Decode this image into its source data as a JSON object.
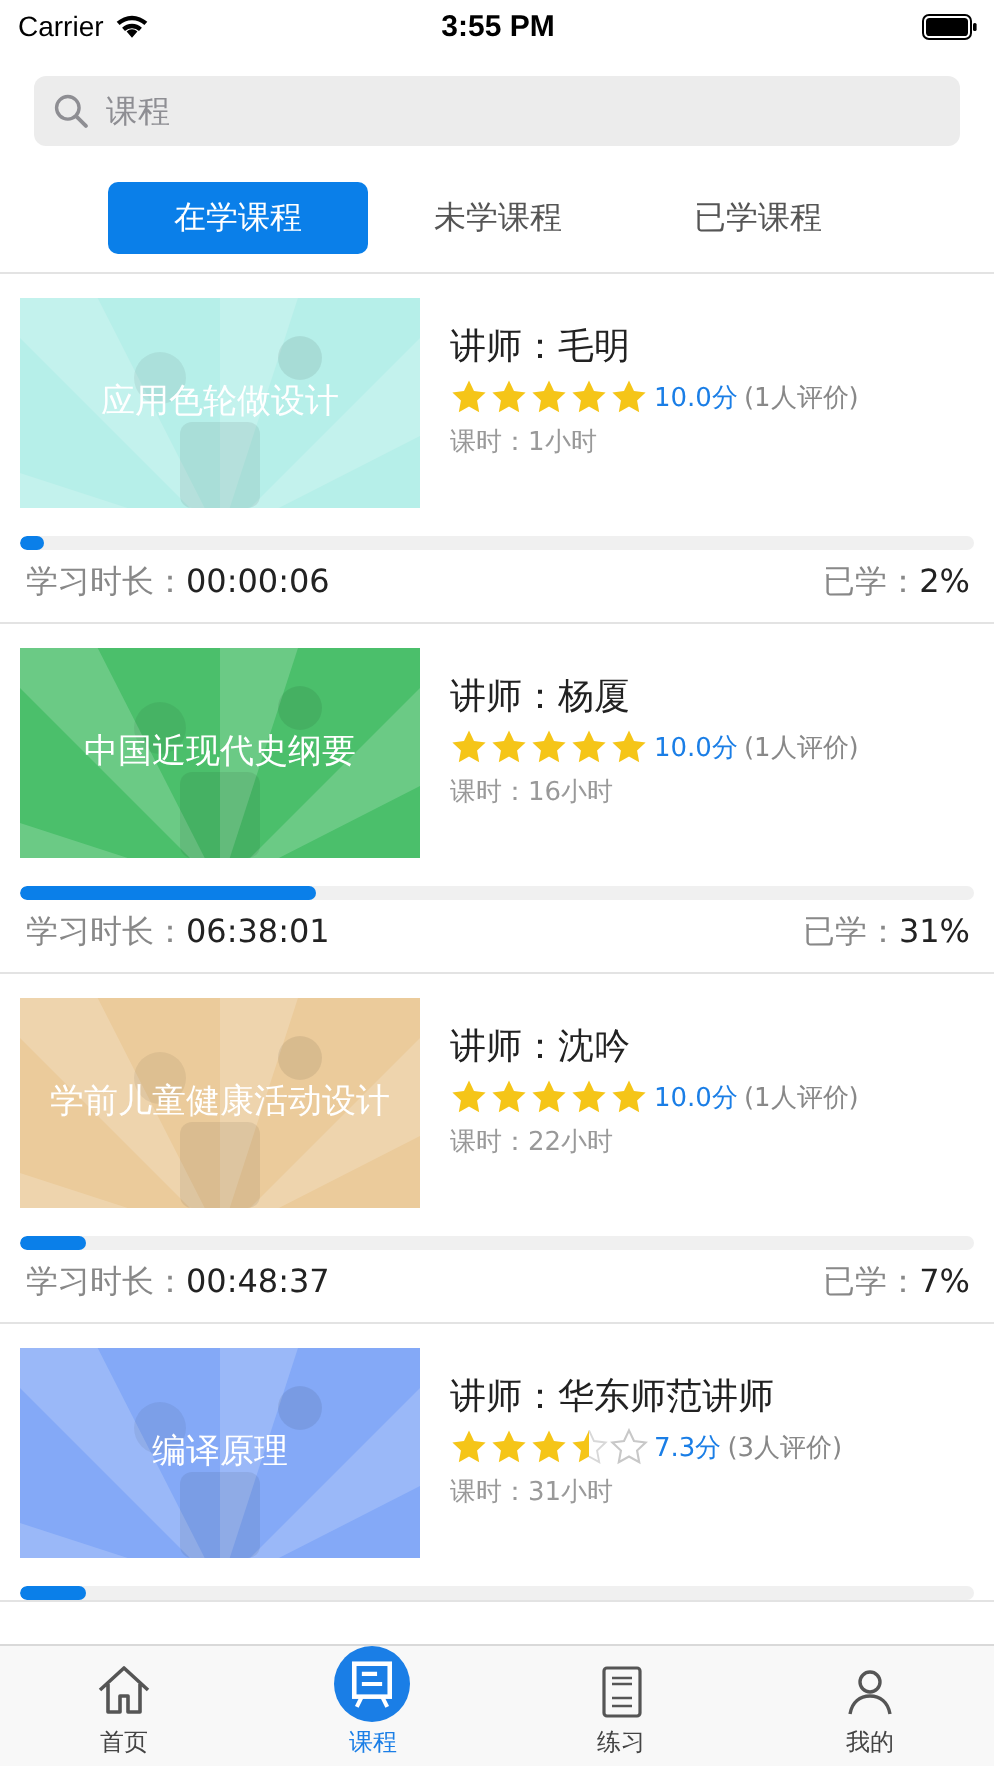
{
  "status_bar": {
    "carrier": "Carrier",
    "time": "3:55 PM"
  },
  "search": {
    "placeholder": "课程"
  },
  "tabs": [
    {
      "label": "在学课程",
      "selected": true
    },
    {
      "label": "未学课程",
      "selected": false
    },
    {
      "label": "已学课程",
      "selected": false
    }
  ],
  "courses": [
    {
      "cover_title": "应用色轮做设计",
      "color": "#b6efe9",
      "teacher_label": "讲师：",
      "teacher": "毛明",
      "stars": 5,
      "score": "10.0分",
      "reviews": "(1人评价)",
      "hours": "课时：1小时",
      "level": 0.02,
      "duration_label": "学习时长：",
      "duration": "00:00:06",
      "percent_label": "已学：",
      "percent": "2%"
    },
    {
      "cover_title": "中国近现代史纲要",
      "color": "#4bbf6b",
      "teacher_label": "讲师：",
      "teacher": "杨厦",
      "stars": 5,
      "score": "10.0分",
      "reviews": "(1人评价)",
      "hours": "课时：16小时",
      "level": 0.31,
      "duration_label": "学习时长：",
      "duration": "06:38:01",
      "percent_label": "已学：",
      "percent": "31%"
    },
    {
      "cover_title": "学前儿童健康活动设计",
      "color": "#ebcb9b",
      "teacher_label": "讲师：",
      "teacher": "沈吟",
      "stars": 5,
      "score": "10.0分",
      "reviews": "(1人评价)",
      "hours": "课时：22小时",
      "level": 0.07,
      "duration_label": "学习时长：",
      "duration": "00:48:37",
      "percent_label": "已学：",
      "percent": "7%"
    },
    {
      "cover_title": "编译原理",
      "color": "#84a9f7",
      "teacher_label": "讲师：",
      "teacher": "华东师范讲师",
      "stars": 3.5,
      "score": "7.3分",
      "reviews": "(3人评价)",
      "hours": "课时：31小时",
      "level": 0.07
    }
  ],
  "tab_bar": [
    {
      "kind": "home",
      "label": "首页",
      "selected": false
    },
    {
      "kind": "course",
      "label": "课程",
      "selected": true
    },
    {
      "kind": "practice",
      "label": "练习",
      "selected": false
    },
    {
      "kind": "profile",
      "label": "我的",
      "selected": false
    }
  ]
}
